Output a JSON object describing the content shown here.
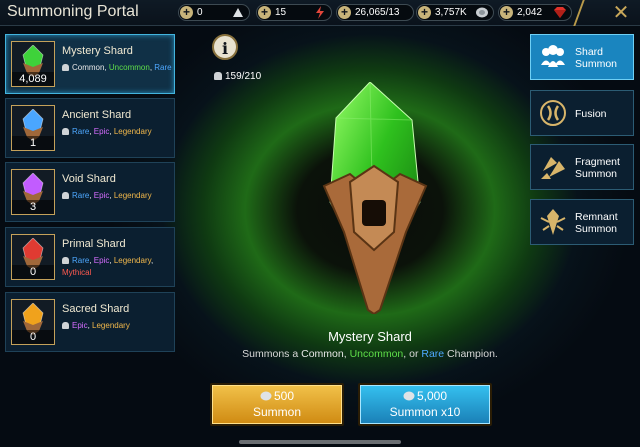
{
  "header": {
    "title": "Summoning Portal"
  },
  "resources": [
    {
      "name": "silver-coins",
      "value": "0"
    },
    {
      "name": "energy",
      "value": "15"
    },
    {
      "name": "arena-tokens",
      "value": "26,065/13"
    },
    {
      "name": "silver",
      "value": "3,757K"
    },
    {
      "name": "gems",
      "value": "2,042"
    }
  ],
  "shards": [
    {
      "name": "Mystery Shard",
      "count": "4,089",
      "color": "#3ed23a",
      "rarities": [
        {
          "label": "Common",
          "sep": ", "
        },
        {
          "label": "Uncommon",
          "sep": ", "
        },
        {
          "label": "Rare",
          "sep": ""
        }
      ]
    },
    {
      "name": "Ancient Shard",
      "count": "1",
      "color": "#4aa6ff",
      "rarities": [
        {
          "label": "Rare",
          "sep": ", "
        },
        {
          "label": "Epic",
          "sep": ", "
        },
        {
          "label": "Legendary",
          "sep": ""
        }
      ]
    },
    {
      "name": "Void Shard",
      "count": "3",
      "color": "#c25cff",
      "rarities": [
        {
          "label": "Rare",
          "sep": ", "
        },
        {
          "label": "Epic",
          "sep": ", "
        },
        {
          "label": "Legendary",
          "sep": ""
        }
      ]
    },
    {
      "name": "Primal Shard",
      "count": "0",
      "color": "#e03b32",
      "rarities": [
        {
          "label": "Rare",
          "sep": ", "
        },
        {
          "label": "Epic",
          "sep": ", "
        },
        {
          "label": "Legendary",
          "sep": ", "
        },
        {
          "label": "Mythical",
          "sep": ""
        }
      ]
    },
    {
      "name": "Sacred Shard",
      "count": "0",
      "color": "#f0a21c",
      "rarities": [
        {
          "label": "Epic",
          "sep": ", "
        },
        {
          "label": "Legendary",
          "sep": ""
        }
      ]
    }
  ],
  "main": {
    "pity": "159/210",
    "title": "Mystery Shard",
    "desc_prefix": "Summons a ",
    "desc_common": "Common",
    "desc_sep1": ", ",
    "desc_uncommon": "Uncommon",
    "desc_sep2": ", or ",
    "desc_rare": "Rare",
    "desc_suffix": " Champion."
  },
  "buttons": {
    "summon": {
      "cost": "500",
      "label": "Summon"
    },
    "summon10": {
      "cost": "5,000",
      "label": "Summon x10"
    }
  },
  "side_menu": [
    {
      "label": "Shard Summon",
      "active": true,
      "icon": "people-icon"
    },
    {
      "label": "Fusion",
      "active": false,
      "icon": "fusion-icon"
    },
    {
      "label": "Fragment Summon",
      "active": false,
      "icon": "fragment-icon"
    },
    {
      "label": "Remnant Summon",
      "active": false,
      "icon": "remnant-icon"
    }
  ],
  "colors": {
    "common": "#e7e7e7",
    "uncommon": "#5ede49",
    "rare": "#4ea8ff",
    "epic": "#d66cff",
    "legendary": "#f2b84b",
    "mythical": "#ff5a4f"
  }
}
